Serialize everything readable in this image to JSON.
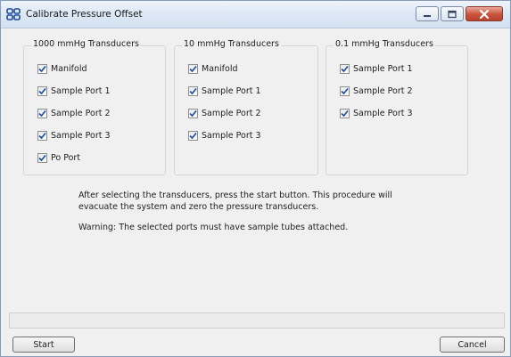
{
  "window": {
    "title": "Calibrate Pressure Offset",
    "icon": "app-logo-icon"
  },
  "groups": [
    {
      "title": "1000 mmHg Transducers",
      "items": [
        {
          "label": "Manifold",
          "checked": true
        },
        {
          "label": "Sample Port 1",
          "checked": true
        },
        {
          "label": "Sample Port 2",
          "checked": true
        },
        {
          "label": "Sample Port 3",
          "checked": true
        },
        {
          "label": "Po Port",
          "checked": true
        }
      ]
    },
    {
      "title": "10 mmHg Transducers",
      "items": [
        {
          "label": "Manifold",
          "checked": true
        },
        {
          "label": "Sample Port 1",
          "checked": true
        },
        {
          "label": "Sample Port 2",
          "checked": true
        },
        {
          "label": "Sample Port 3",
          "checked": true
        }
      ]
    },
    {
      "title": "0.1 mmHg Transducers",
      "items": [
        {
          "label": "Sample Port 1",
          "checked": true
        },
        {
          "label": "Sample Port 2",
          "checked": true
        },
        {
          "label": "Sample Port 3",
          "checked": true
        }
      ]
    }
  ],
  "info": {
    "line1": "After selecting the transducers, press the start button. This procedure will",
    "line2": "evacuate the system and zero the pressure transducers.",
    "warning": "Warning: The selected ports must have sample tubes attached."
  },
  "buttons": {
    "start": "Start",
    "cancel": "Cancel"
  },
  "colors": {
    "checkmark": "#1f4a9e",
    "close_button": "#c9523a"
  }
}
